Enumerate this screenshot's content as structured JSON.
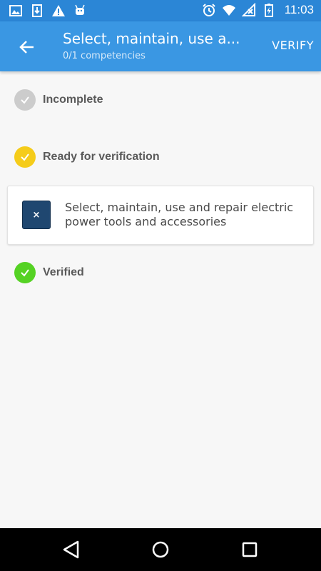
{
  "status_bar": {
    "time": "11:03",
    "icons_left": [
      "image-icon",
      "download-icon",
      "warning-icon",
      "android-icon"
    ],
    "icons_right": [
      "alarm-icon",
      "wifi-icon",
      "no-signal-icon",
      "battery-icon"
    ]
  },
  "app_bar": {
    "title": "Select, maintain, use a...",
    "subtitle": "0/1 competencies",
    "verify_label": "VERIFY"
  },
  "sections": {
    "incomplete": {
      "label": "Incomplete",
      "color": "#cccccc"
    },
    "ready": {
      "label": "Ready for verification",
      "color": "#f5cc1a"
    },
    "verified": {
      "label": "Verified",
      "color": "#55d224"
    }
  },
  "card": {
    "icon_text": "×",
    "text": "Select, maintain, use and repair electric power tools and accessories",
    "icon_color": "#1f4770"
  },
  "colors": {
    "status_bar": "#2b86d6",
    "app_bar": "#3a97e3",
    "background": "#f7f7f7"
  }
}
